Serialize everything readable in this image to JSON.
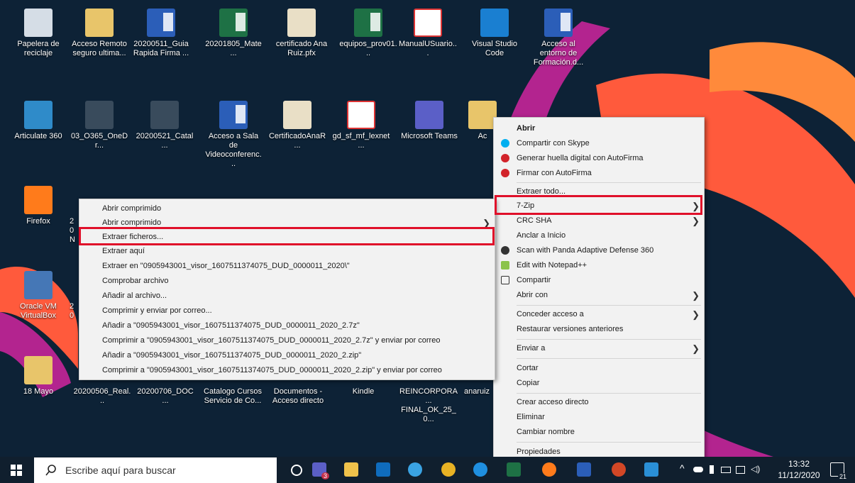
{
  "desktop": {
    "icons": [
      {
        "label": "Papelera de reciclaje",
        "type": "recycle-bin"
      },
      {
        "label": "Acceso Remoto seguro ultima...",
        "type": "pdf-folder"
      },
      {
        "label": "20200511_Guia Rapida Firma ...",
        "type": "word"
      },
      {
        "label": "20201805_Mate...",
        "type": "excel"
      },
      {
        "label": "certificado Ana Ruiz.pfx",
        "type": "certificate"
      },
      {
        "label": "equipos_prov01...",
        "type": "excel"
      },
      {
        "label": "ManualUSuario...",
        "type": "pdf"
      },
      {
        "label": "Visual Studio Code",
        "type": "vscode"
      },
      {
        "label": "Acceso al entorno de Formación.d...",
        "type": "word"
      },
      {
        "label": "Articulate 360",
        "type": "articulate"
      },
      {
        "label": "03_O365_OneDr...",
        "type": "video"
      },
      {
        "label": "20200521_Catal...",
        "type": "powerpoint"
      },
      {
        "label": "Acceso a Sala de Videoconferenc...",
        "type": "word"
      },
      {
        "label": "CertificadoAnaR...",
        "type": "certificate"
      },
      {
        "label": "gd_sf_mf_lexnet...",
        "type": "pdf"
      },
      {
        "label": "Microsoft Teams",
        "type": "teams"
      },
      {
        "label": "Ac",
        "type": "archive"
      },
      {
        "label": "Firefox",
        "type": "firefox"
      },
      {
        "label": "Oracle VM VirtualBox",
        "type": "virtualbox"
      },
      {
        "label": "18 Mayo",
        "type": "archive"
      },
      {
        "label": "20200506_Real...",
        "type": "generic"
      },
      {
        "label": "20200706_DOC...",
        "type": "generic"
      },
      {
        "label": "Catalogo Cursos Servicio de Co...",
        "type": "generic"
      },
      {
        "label": "Documentos - Acceso directo",
        "type": "generic"
      },
      {
        "label": "Kindle",
        "type": "generic"
      },
      {
        "label": "REINCORPORA... FINAL_OK_25_0...",
        "type": "generic"
      },
      {
        "label": "anaruiz",
        "type": "generic"
      }
    ],
    "partial_labels": [
      "20",
      "N",
      "20"
    ]
  },
  "context_menu": {
    "items": [
      {
        "label": "Abrir",
        "bold": true
      },
      {
        "label": "Compartir con Skype",
        "icon": "skype-icon",
        "icon_color": "#00aff0"
      },
      {
        "label": "Generar huella digital con AutoFirma",
        "icon": "autofirma-icon",
        "icon_color": "#d2232a"
      },
      {
        "label": "Firmar con AutoFirma",
        "icon": "autofirma-icon",
        "icon_color": "#d2232a"
      },
      {
        "label": "Extraer todo..."
      },
      {
        "label": "7-Zip",
        "submenu": true,
        "highlighted": true
      },
      {
        "label": "CRC SHA",
        "submenu": true
      },
      {
        "label": "Anclar a Inicio"
      },
      {
        "label": "Scan with Panda Adaptive Defense 360",
        "icon": "panda-icon",
        "icon_color": "#333333"
      },
      {
        "label": "Edit with Notepad++",
        "icon": "notepad-plus-icon",
        "icon_color": "#8bc34a"
      },
      {
        "label": "Compartir",
        "icon": "share-icon",
        "icon_color": "#333333"
      },
      {
        "label": "Abrir con",
        "submenu": true
      },
      {
        "label": "Conceder acceso a",
        "submenu": true
      },
      {
        "label": "Restaurar versiones anteriores"
      },
      {
        "label": "Enviar a",
        "submenu": true
      },
      {
        "label": "Cortar"
      },
      {
        "label": "Copiar"
      },
      {
        "label": "Crear acceso directo"
      },
      {
        "label": "Eliminar"
      },
      {
        "label": "Cambiar nombre"
      },
      {
        "label": "Propiedades"
      }
    ]
  },
  "zip_submenu": {
    "items": [
      {
        "label": "Abrir comprimido"
      },
      {
        "label": "Abrir comprimido",
        "submenu": true
      },
      {
        "label": "Extraer ficheros...",
        "highlighted": true
      },
      {
        "label": "Extraer aquí"
      },
      {
        "label": "Extraer en \"0905943001_visor_1607511374075_DUD_0000011_2020\\\""
      },
      {
        "label": "Comprobar archivo"
      },
      {
        "label": "Añadir al archivo..."
      },
      {
        "label": "Comprimir y enviar por correo..."
      },
      {
        "label": "Añadir a \"0905943001_visor_1607511374075_DUD_0000011_2020_2.7z\""
      },
      {
        "label": "Comprimir a \"0905943001_visor_1607511374075_DUD_0000011_2020_2.7z\" y enviar por correo"
      },
      {
        "label": "Añadir a \"0905943001_visor_1607511374075_DUD_0000011_2020_2.zip\""
      },
      {
        "label": "Comprimir a \"0905943001_visor_1607511374075_DUD_0000011_2020_2.zip\" y enviar por correo"
      }
    ]
  },
  "taskbar": {
    "search_placeholder": "Escribe aquí para buscar",
    "teams_badge": "3",
    "clock_time": "13:32",
    "clock_date": "11/12/2020",
    "notification_count": "21",
    "apps": [
      "task-view",
      "teams",
      "file-explorer",
      "outlook",
      "internet-explorer",
      "chrome",
      "edge",
      "excel",
      "firefox",
      "word",
      "powerpoint",
      "media-player"
    ]
  },
  "colors": {
    "highlight_border": "#e0102a",
    "taskbar_bg": "#101f2e",
    "menu_bg": "#f2f2f2",
    "desktop_bg": "#0d2236"
  }
}
